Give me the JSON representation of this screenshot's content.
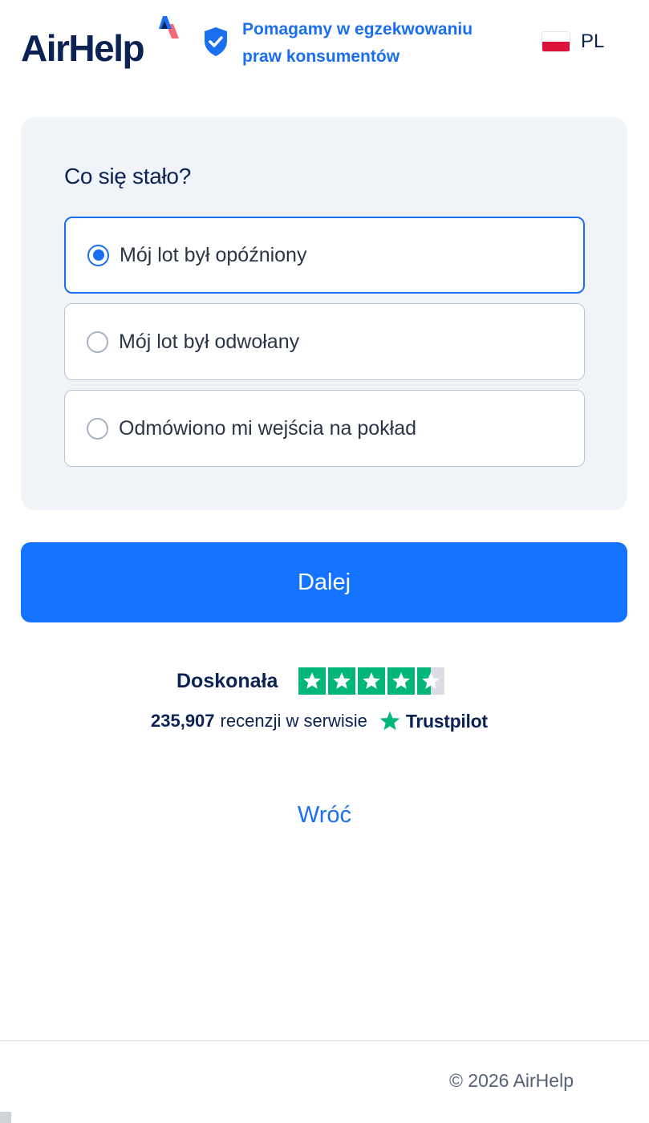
{
  "header": {
    "logo_text": "AirHelp",
    "tagline_line1": "Pomagamy w egzekwowaniu",
    "tagline_line2": "praw konsumentów",
    "language_code": "PL",
    "icons": [
      "airhelp-logo-mark-icon",
      "shield-check-icon",
      "poland-flag-icon"
    ]
  },
  "form": {
    "question": "Co się stało?",
    "options": [
      {
        "label": "Mój lot był opóźniony",
        "selected": true
      },
      {
        "label": "Mój lot był odwołany",
        "selected": false
      },
      {
        "label": "Odmówiono mi wejścia na pokład",
        "selected": false
      }
    ],
    "next_button_label": "Dalej"
  },
  "trustpilot": {
    "rating_word": "Doskonała",
    "stars_rating": 4.5,
    "review_count": "235,907",
    "review_text": "recenzji w serwisie",
    "brand": "Trustpilot"
  },
  "back_link_label": "Wróć",
  "footer": {
    "copyright": "© 2026 AirHelp"
  },
  "colors": {
    "primary_blue": "#1474ff",
    "link_blue": "#1a6ff0",
    "navy": "#0b2354",
    "card_bg": "#f0f3f8",
    "trustpilot_green": "#00b67a"
  }
}
